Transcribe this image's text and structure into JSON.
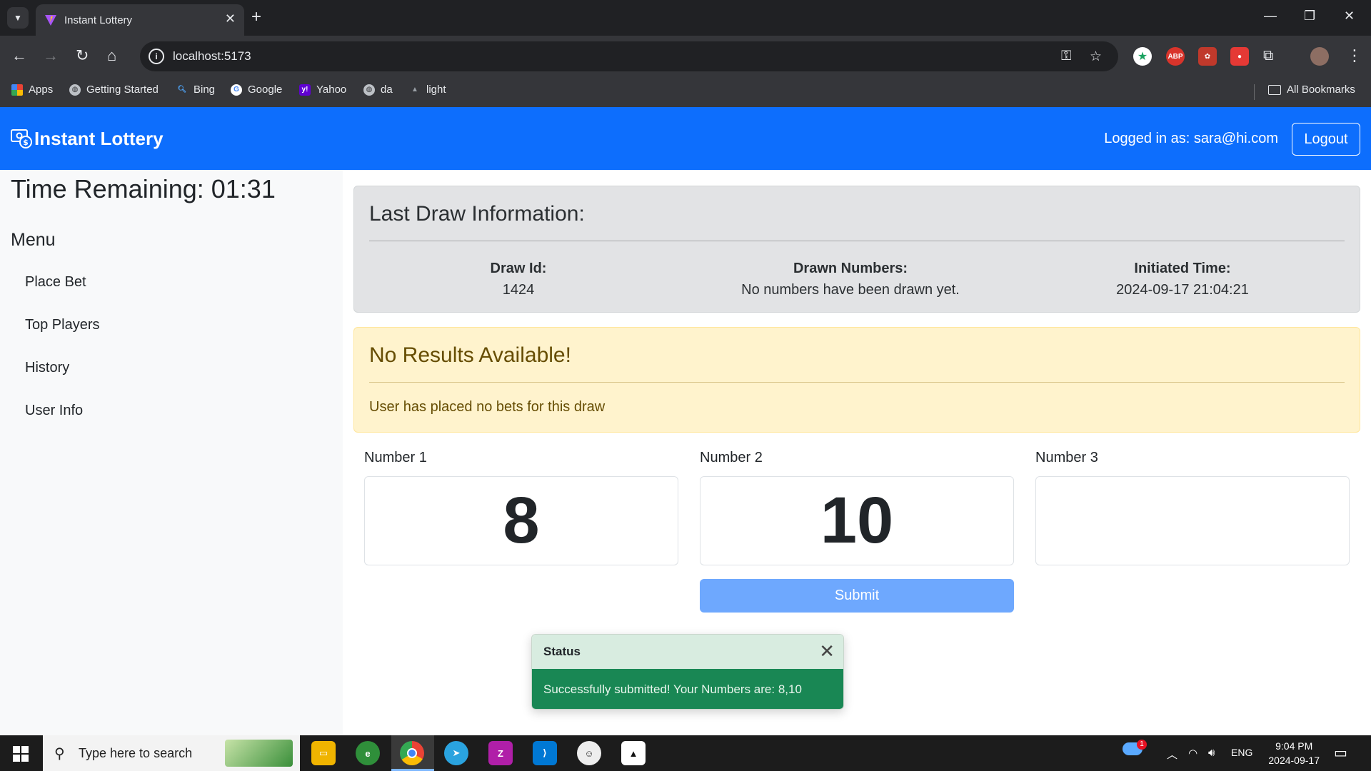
{
  "browser": {
    "tab_title": "Instant Lottery",
    "url": "localhost:5173",
    "bookmarks": [
      {
        "label": "Apps",
        "icon": "apps-grid-icon"
      },
      {
        "label": "Getting Started",
        "icon": "globe-icon"
      },
      {
        "label": "Bing",
        "icon": "search-icon"
      },
      {
        "label": "Google",
        "icon": "google-icon"
      },
      {
        "label": "Yahoo",
        "icon": "yahoo-icon"
      },
      {
        "label": "da",
        "icon": "globe-icon"
      },
      {
        "label": "light",
        "icon": "hat-icon"
      }
    ],
    "all_bookmarks": "All Bookmarks",
    "extensions": [
      {
        "name": "star-extension-icon",
        "text": "★",
        "color": "#1aa260"
      },
      {
        "name": "adblock-plus-icon",
        "text": "ABP",
        "color": "#d9342b"
      },
      {
        "name": "puzzle-red-extension-icon",
        "text": "✿",
        "color": "#c0392b"
      },
      {
        "name": "record-extension-icon",
        "text": "●",
        "color": "#e53935"
      }
    ]
  },
  "app": {
    "brand": "Instant Lottery",
    "logged_in_text": "Logged in as: sara@hi.com",
    "logout": "Logout",
    "accent_color": "#0d6efd"
  },
  "sidebar": {
    "time_remaining": "Time Remaining: 01:31",
    "menu_title": "Menu",
    "items": [
      {
        "label": "Place Bet"
      },
      {
        "label": "Top Players"
      },
      {
        "label": "History"
      },
      {
        "label": "User Info"
      }
    ]
  },
  "last_draw": {
    "title": "Last Draw Information:",
    "draw_id_label": "Draw Id:",
    "draw_id": "1424",
    "drawn_label": "Drawn Numbers:",
    "drawn_value": "No numbers have been drawn yet.",
    "time_label": "Initiated Time:",
    "time_value": "2024-09-17 21:04:21"
  },
  "results": {
    "title": "No Results Available!",
    "message": "User has placed no bets for this draw"
  },
  "bet_form": {
    "fields": [
      {
        "label": "Number 1",
        "value": "8"
      },
      {
        "label": "Number 2",
        "value": "10"
      },
      {
        "label": "Number 3",
        "value": ""
      }
    ],
    "submit": "Submit"
  },
  "toast": {
    "title": "Status",
    "message": "Successfully submitted! Your Numbers are: 8,10"
  },
  "taskbar": {
    "search_placeholder": "Type here to search",
    "language": "ENG",
    "time": "9:04 PM",
    "date": "2024-09-17",
    "weather_badge": "1"
  }
}
